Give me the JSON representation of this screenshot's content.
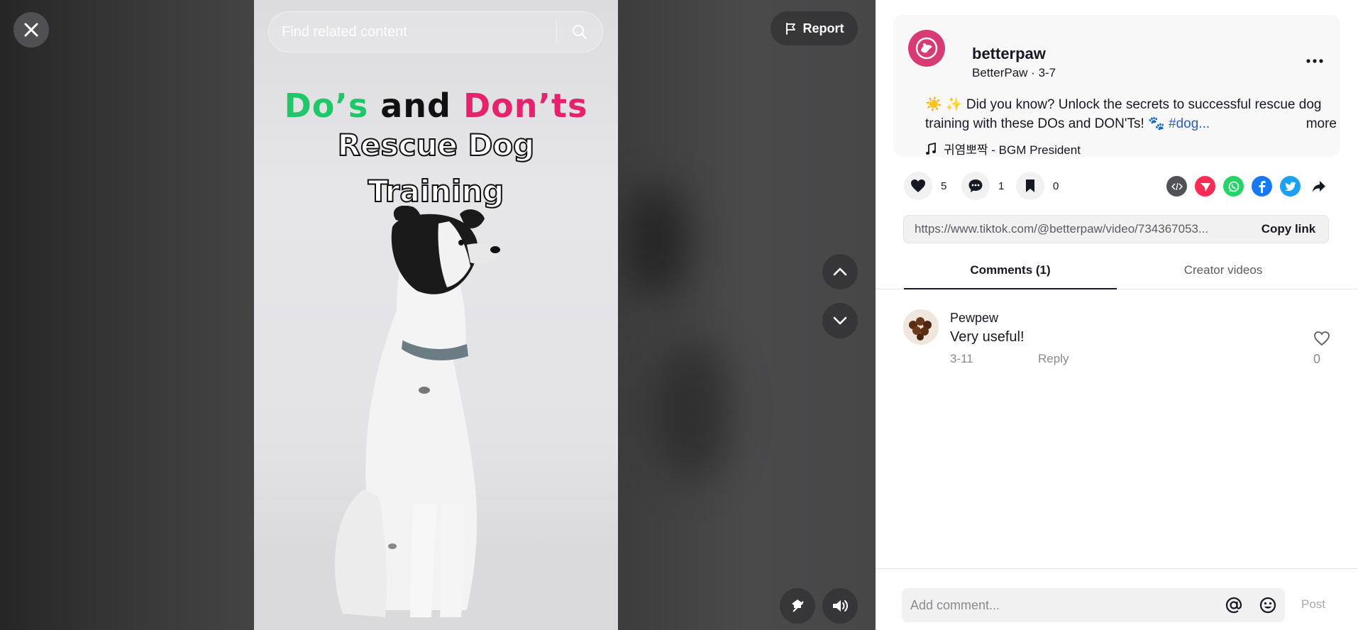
{
  "search": {
    "placeholder": "Find related content"
  },
  "video": {
    "title_do": "Do’s",
    "title_and": "and",
    "title_dont": "Don’ts",
    "title_line2": "Rescue Dog",
    "title_line3": "Training"
  },
  "controls": {
    "report_label": "Report"
  },
  "author": {
    "username": "betterpaw",
    "display_name": "BetterPaw",
    "date": "3-7",
    "description_text": "☀️ ✨ Did you know? Unlock the secrets to successful rescue dog training with these DOs and DON'Ts! 🐾 ",
    "hashtag": "#dog...",
    "more_label": "more",
    "music": "귀염뽀짝 - BGM President"
  },
  "stats": {
    "likes": "5",
    "comments": "1",
    "saves": "0"
  },
  "share": {
    "link": "https://www.tiktok.com/@betterpaw/video/734367053...",
    "copy_label": "Copy link"
  },
  "tabs": [
    {
      "label": "Comments (1)"
    },
    {
      "label": "Creator videos"
    }
  ],
  "comments": [
    {
      "user": "Pewpew",
      "text": "Very useful!",
      "date": "3-11",
      "reply_label": "Reply",
      "likes": "0"
    }
  ],
  "composer": {
    "placeholder": "Add comment...",
    "post_label": "Post"
  },
  "colors": {
    "brand_pink": "#d63b74",
    "tag_blue": "#2b5db9",
    "title_green": "#1ec86a",
    "title_pink": "#e5226b"
  }
}
